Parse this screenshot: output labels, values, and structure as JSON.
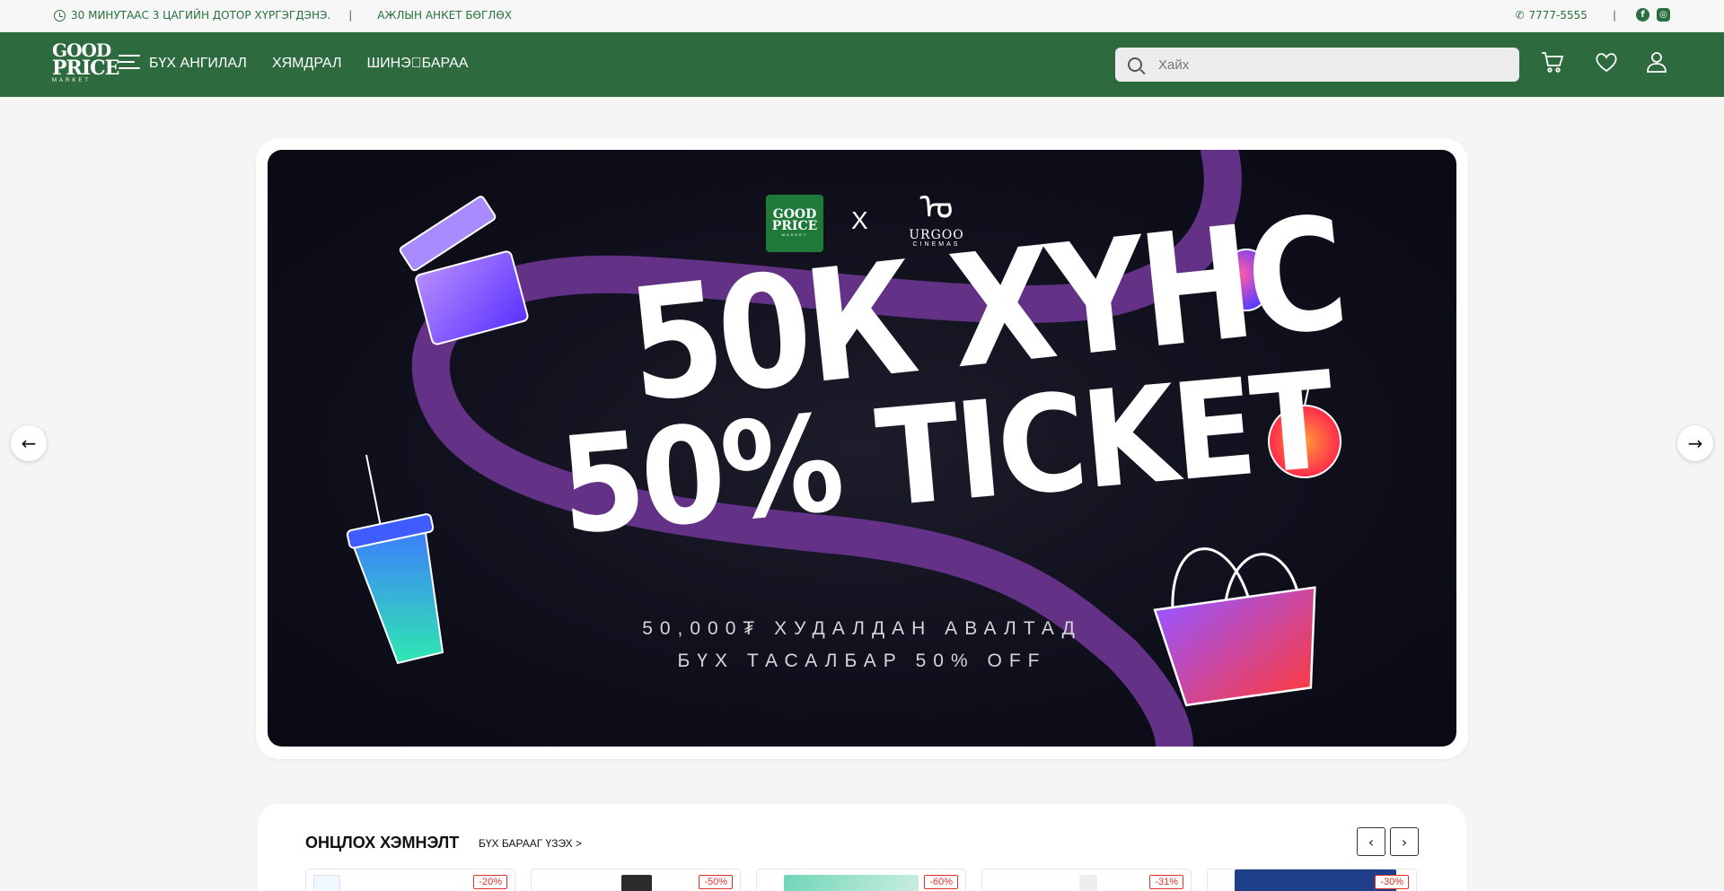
{
  "topbar": {
    "delivery_text": "30 МИНУТААС 3 ЦАГИЙН ДОТОР ХҮРГЭГДЭНЭ.",
    "separator": "|",
    "jobs_link": "АЖЛЫН АНКЕТ БӨГЛӨХ",
    "phone": "7777-5555",
    "separator_right": "|",
    "facebook_glyph": "f",
    "instagram_glyph": "◎"
  },
  "nav": {
    "logo_line1": "GOOD",
    "logo_line2": "PRICE",
    "logo_line3": "MARKET",
    "links": [
      "БҮХ АНГИЛАЛ",
      "ХЯМДРАЛ",
      "ШИНЭ\u0000БАРАА"
    ],
    "search_placeholder": "Хайх"
  },
  "banner": {
    "partner_logo_line1": "GOOD",
    "partner_logo_line2": "PRICE",
    "partner_logo_line3": "MARKET",
    "x_symbol": "X",
    "urgoo_name": "URGOO",
    "urgoo_sub": "CINEMAS",
    "headline_1": "50К ХҮНС",
    "headline_2": "50% TICKET",
    "subline_1": "50,000₮ ХУДАЛДАН АВАЛТАД",
    "subline_2": "БҮХ ТАСАЛБАР 50% OFF",
    "prev_glyph": "←",
    "next_glyph": "→"
  },
  "featured": {
    "title": "ОНЦЛОХ ХЭМНЭЛТ",
    "view_all": "БҮХ БАРААГ ҮЗЭХ >",
    "prev_glyph": "‹",
    "next_glyph": "›",
    "cards": [
      {
        "discount": "-20%"
      },
      {
        "discount": "-50%"
      },
      {
        "discount": "-60%"
      },
      {
        "discount": "-31%"
      },
      {
        "discount": "-30%"
      }
    ]
  },
  "colors": {
    "brand_green": "#2d6a3e",
    "discount_red": "#e1322a"
  }
}
